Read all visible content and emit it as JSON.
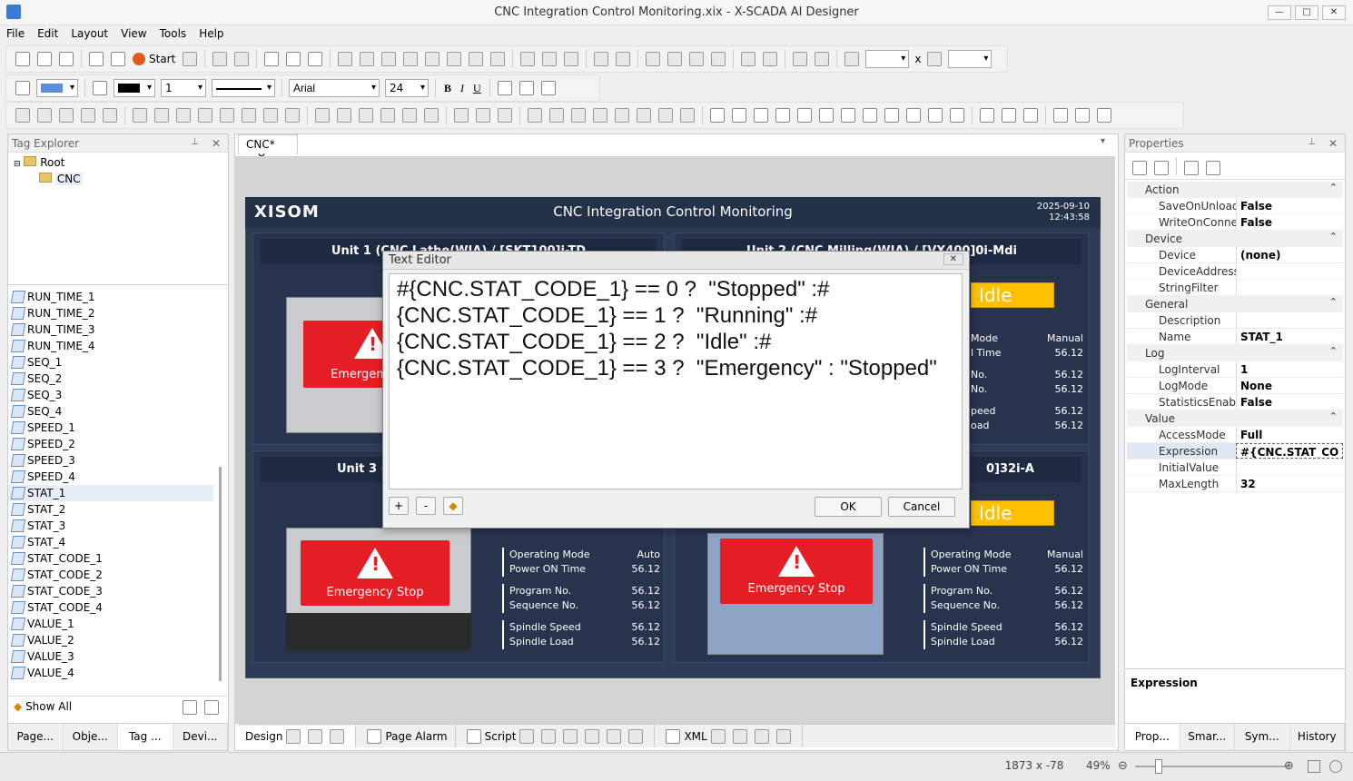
{
  "window": {
    "title": "CNC Integration Control Monitoring.xix - X-SCADA AI Designer"
  },
  "menu": [
    "File",
    "Edit",
    "Layout",
    "View",
    "Tools",
    "Help"
  ],
  "toolbar": {
    "start_label": "Start",
    "x_label": "x",
    "font": "Arial",
    "font_size": "24",
    "line_width": "1"
  },
  "tag_explorer": {
    "title": "Tag Explorer",
    "root": "Root",
    "folder": "CNC",
    "tags": [
      "RUN_TIME_1",
      "RUN_TIME_2",
      "RUN_TIME_3",
      "RUN_TIME_4",
      "SEQ_1",
      "SEQ_2",
      "SEQ_3",
      "SEQ_4",
      "SPEED_1",
      "SPEED_2",
      "SPEED_3",
      "SPEED_4",
      "STAT_1",
      "STAT_2",
      "STAT_3",
      "STAT_4",
      "STAT_CODE_1",
      "STAT_CODE_2",
      "STAT_CODE_3",
      "STAT_CODE_4",
      "VALUE_1",
      "VALUE_2",
      "VALUE_3",
      "VALUE_4"
    ],
    "selected": "STAT_1",
    "show_all": "Show All",
    "bottom_tabs": [
      "Page...",
      "Obje...",
      "Tag ...",
      "Devi..."
    ]
  },
  "doc_tab": "CNC*",
  "hmi": {
    "logo": "XISOM",
    "title": "CNC Integration Control Monitoring",
    "date": "2025-09-10",
    "time": "12:43:58",
    "unit1_title": "Unit 1 (CNC Lathe(WIA) / [SKT100]i-TD",
    "unit2_title": "Unit 2 (CNC Milling(WIA) / [VX400]0i-Mdi",
    "unit3_title": "Unit 3 (",
    "unit4_title": "0]32i-A",
    "idle": "Idle",
    "emergency_short": "Emergenc",
    "estop": "Emergency Stop",
    "unit3_info": {
      "op_mode": "Operating Mode",
      "op_val": "Auto",
      "pow": "Power ON Time",
      "pow_val": "56.12",
      "prog": "Program No.",
      "prog_val": "56.12",
      "seq": "Sequence No.",
      "seq_val": "56.12",
      "spd": "Spindle Speed",
      "spd_val": "56.12",
      "load": "Spindle Load",
      "load_val": "56.12"
    },
    "unit4_info": {
      "op_mode": "Operating Mode",
      "op_val": "Manual",
      "pow": "Power ON Time",
      "pow_val": "56.12",
      "prog": "Program No.",
      "prog_val": "56.12",
      "seq": "Sequence No.",
      "seq_val": "56.12",
      "spd": "Spindle Speed",
      "spd_val": "56.12",
      "load": "Spindle Load",
      "load_val": "56.12"
    },
    "unit2_partial": {
      "mode": "Mode",
      "mode_val": "Manual",
      "time": "l Time",
      "time_val": "56.12",
      "no1": "No.",
      "no1_val": "56.12",
      "no2": "No.",
      "no2_val": "56.12",
      "peed": "peed",
      "peed_val": "56.12",
      "oad": "oad",
      "oad_val": "56.12"
    }
  },
  "text_editor": {
    "title": "Text Editor",
    "content": "#{CNC.STAT_CODE_1} == 0 ?  \"Stopped\" :#\n{CNC.STAT_CODE_1} == 1 ?  \"Running\" :#\n{CNC.STAT_CODE_1} == 2 ?  \"Idle\" :#\n{CNC.STAT_CODE_1} == 3 ?  \"Emergency\" : \"Stopped\"",
    "plus": "+",
    "minus": "-",
    "ok": "OK",
    "cancel": "Cancel"
  },
  "properties": {
    "title": "Properties",
    "categories": [
      {
        "name": "Action",
        "rows": [
          [
            "SaveOnUnload",
            "False"
          ],
          [
            "WriteOnConnect",
            "False"
          ]
        ]
      },
      {
        "name": "Device",
        "rows": [
          [
            "Device",
            "(none)"
          ],
          [
            "DeviceAddress",
            ""
          ],
          [
            "StringFilter",
            ""
          ]
        ]
      },
      {
        "name": "General",
        "rows": [
          [
            "Description",
            ""
          ],
          [
            "Name",
            "STAT_1"
          ]
        ]
      },
      {
        "name": "Log",
        "rows": [
          [
            "LogInterval",
            "1"
          ],
          [
            "LogMode",
            "None"
          ],
          [
            "StatisticsEnable",
            "False"
          ]
        ]
      },
      {
        "name": "Value",
        "rows": [
          [
            "AccessMode",
            "Full"
          ],
          [
            "Expression",
            "#{CNC.STAT_CO"
          ],
          [
            "InitialValue",
            ""
          ],
          [
            "MaxLength",
            "32"
          ]
        ]
      }
    ],
    "description_title": "Expression",
    "bottom_tabs": [
      "Prop...",
      "Smar...",
      "Sym...",
      "History"
    ]
  },
  "center_tabs": {
    "design": "Design",
    "page_alarm": "Page Alarm",
    "script": "Script",
    "xml": "XML"
  },
  "status": {
    "coords": "1873 x -78",
    "zoom": "49%"
  }
}
